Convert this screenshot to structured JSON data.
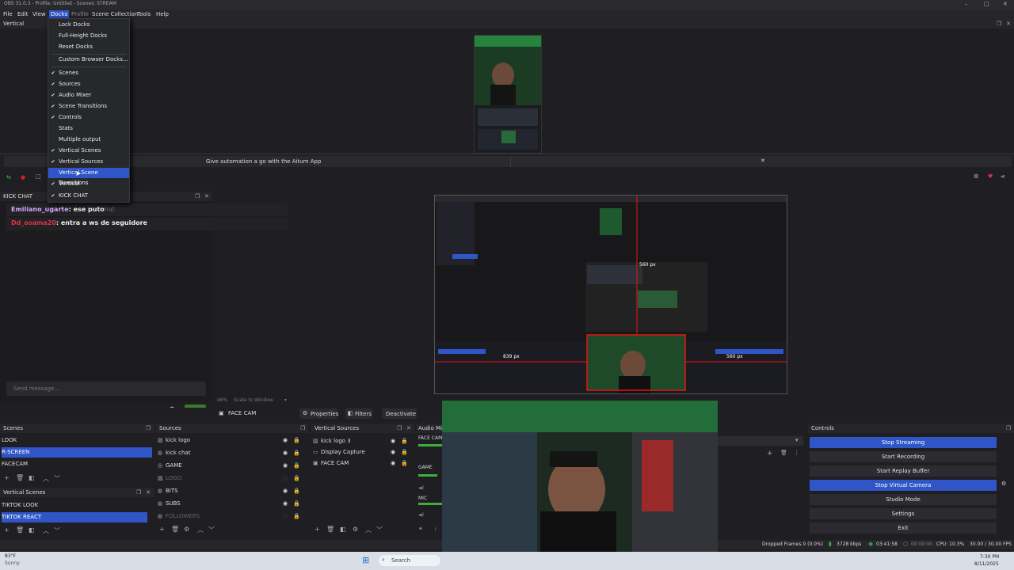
{
  "window": {
    "title": "OBS 31.0.3 - Profile: Untitled - Scenes: STREAM"
  },
  "menu": [
    "File",
    "Edit",
    "View",
    "Docks",
    "Profile",
    "Scene Collection",
    "Tools",
    "Help"
  ],
  "docks_menu": [
    {
      "label": "Lock Docks",
      "checked": false
    },
    {
      "label": "Full-Height Docks",
      "checked": false
    },
    {
      "label": "Reset Docks",
      "checked": false
    },
    {
      "label": "Custom Browser Docks...",
      "checked": false
    },
    {
      "label": "Scenes",
      "checked": true
    },
    {
      "label": "Sources",
      "checked": true
    },
    {
      "label": "Audio Mixer",
      "checked": true
    },
    {
      "label": "Scene Transitions",
      "checked": true
    },
    {
      "label": "Controls",
      "checked": true
    },
    {
      "label": "Stats",
      "checked": false
    },
    {
      "label": "Multiple output",
      "checked": false
    },
    {
      "label": "Vertical Scenes",
      "checked": true
    },
    {
      "label": "Vertical Sources",
      "checked": true
    },
    {
      "label": "Vertical Scene Transitions",
      "checked": false
    },
    {
      "label": "Vertical",
      "checked": true
    },
    {
      "label": "KICK CHAT",
      "checked": true
    }
  ],
  "vertical_panel": {
    "title": "Vertical"
  },
  "banner": {
    "text": "Give automation a go with the Aitum App"
  },
  "kick_chat": {
    "title": "KICK CHAT",
    "messages": [
      {
        "user": "Emiliano_ugarte",
        "text": ": ese puto",
        "ghost": "hat",
        "color": "#d6a5ff"
      },
      {
        "user": "Dd_osama20",
        "text": ": entra a ws de seguidore",
        "color": "#e0334a"
      }
    ],
    "input_placeholder": "Send message...",
    "chat_button": "Chat"
  },
  "canvas_labels": {
    "dim1": "839 px",
    "dim2": "560 px",
    "dim3": "560 px"
  },
  "zoom": {
    "percent": "46%",
    "mode": "Scale to Window"
  },
  "source_toolbar": {
    "source": "FACE CAM",
    "properties": "Properties",
    "filters": "Filters",
    "deactivate": "Deactivate"
  },
  "scenes": {
    "title": "Scenes",
    "items": [
      {
        "label": "LOOK",
        "selected": false
      },
      {
        "label": "R-SCREEN",
        "selected": true
      },
      {
        "label": "FACECAM",
        "selected": false
      }
    ]
  },
  "vertical_scenes": {
    "title": "Vertical Scenes",
    "items": [
      {
        "label": "TIKTOK LOOK",
        "selected": false
      },
      {
        "label": "TIKTOK REACT",
        "selected": true
      }
    ]
  },
  "sources": {
    "title": "Sources",
    "items": [
      {
        "label": "kick logo",
        "dim": false
      },
      {
        "label": "kick chat",
        "dim": false
      },
      {
        "label": "GAME",
        "dim": false
      },
      {
        "label": "LOGO",
        "dim": true
      },
      {
        "label": "BITS",
        "dim": false
      },
      {
        "label": "SUBS",
        "dim": false
      },
      {
        "label": "FOLLOWERS",
        "dim": true
      }
    ]
  },
  "vertical_sources": {
    "title": "Vertical Sources",
    "items": [
      {
        "label": "kick logo 3"
      },
      {
        "label": "Display Capture"
      },
      {
        "label": "FACE CAM"
      }
    ]
  },
  "audio_mixer": {
    "title": "Audio Mix",
    "channels": [
      "FACE CAM",
      "GAME",
      "MIC"
    ]
  },
  "controls": {
    "title": "Controls",
    "buttons": [
      {
        "label": "Stop Streaming",
        "primary": true
      },
      {
        "label": "Start Recording",
        "primary": false
      },
      {
        "label": "Start Replay Buffer",
        "primary": false
      },
      {
        "label": "Stop Virtual Camera",
        "primary": true
      },
      {
        "label": "Studio Mode",
        "primary": false
      },
      {
        "label": "Settings",
        "primary": false
      },
      {
        "label": "Exit",
        "primary": false
      }
    ]
  },
  "status": {
    "dropped": "Dropped Frames 0 (0.0%)",
    "bitrate": "3728 kbps",
    "live_time": "03:41:58",
    "rec_time": "00:00:00",
    "cpu": "CPU: 10.3%",
    "fps": "30.00 / 30.00 FPS"
  },
  "taskbar": {
    "weather_temp": "83°F",
    "weather_text": "Sunny",
    "search": "Search",
    "time": "7:30 PM",
    "date": "8/11/2025"
  },
  "colors": {
    "accent": "#2f55c7",
    "live": "#3fae3f",
    "chat_green": "#3b7a2a"
  }
}
